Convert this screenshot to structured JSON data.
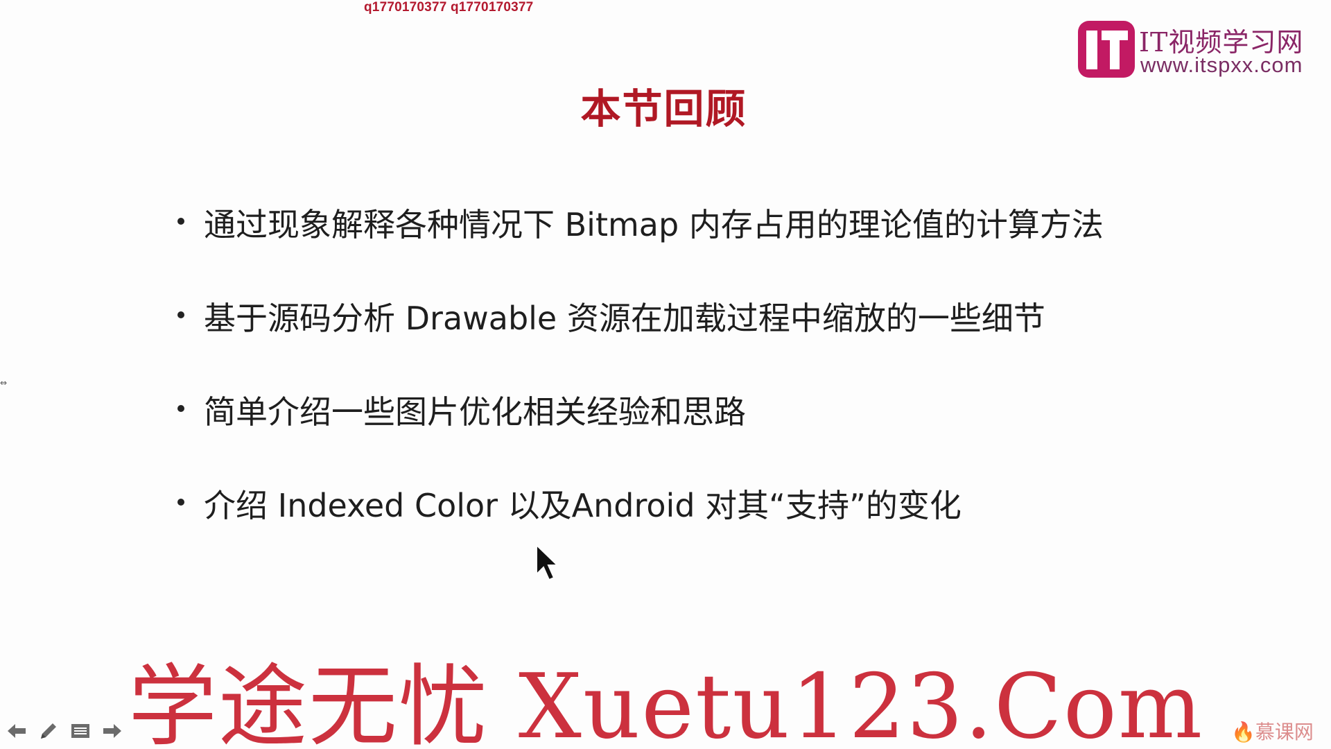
{
  "watermark_top": "q1770170377 q1770170377",
  "logo": {
    "brand": "IT视频学习网",
    "url": "www.itspxx.com"
  },
  "slide": {
    "title": "本节回顾",
    "bullets": [
      "通过现象解释各种情况下 Bitmap 内存占用的理论值的计算方法",
      "基于源码分析 Drawable 资源在加载过程中缩放的一些细节",
      "简单介绍一些图片优化相关经验和思路",
      "介绍 Indexed Color 以及Android 对其“支持”的变化"
    ]
  },
  "watermark_bottom": "学途无忧 Xuetu123.Com",
  "brand_bottom_right": "慕课网",
  "nav_tools": [
    {
      "name": "previous-icon"
    },
    {
      "name": "pen-icon"
    },
    {
      "name": "menu-icon"
    },
    {
      "name": "next-icon"
    }
  ],
  "colors": {
    "title": "#b01824",
    "watermark": "#c8202e",
    "logo": "#c21a63"
  }
}
